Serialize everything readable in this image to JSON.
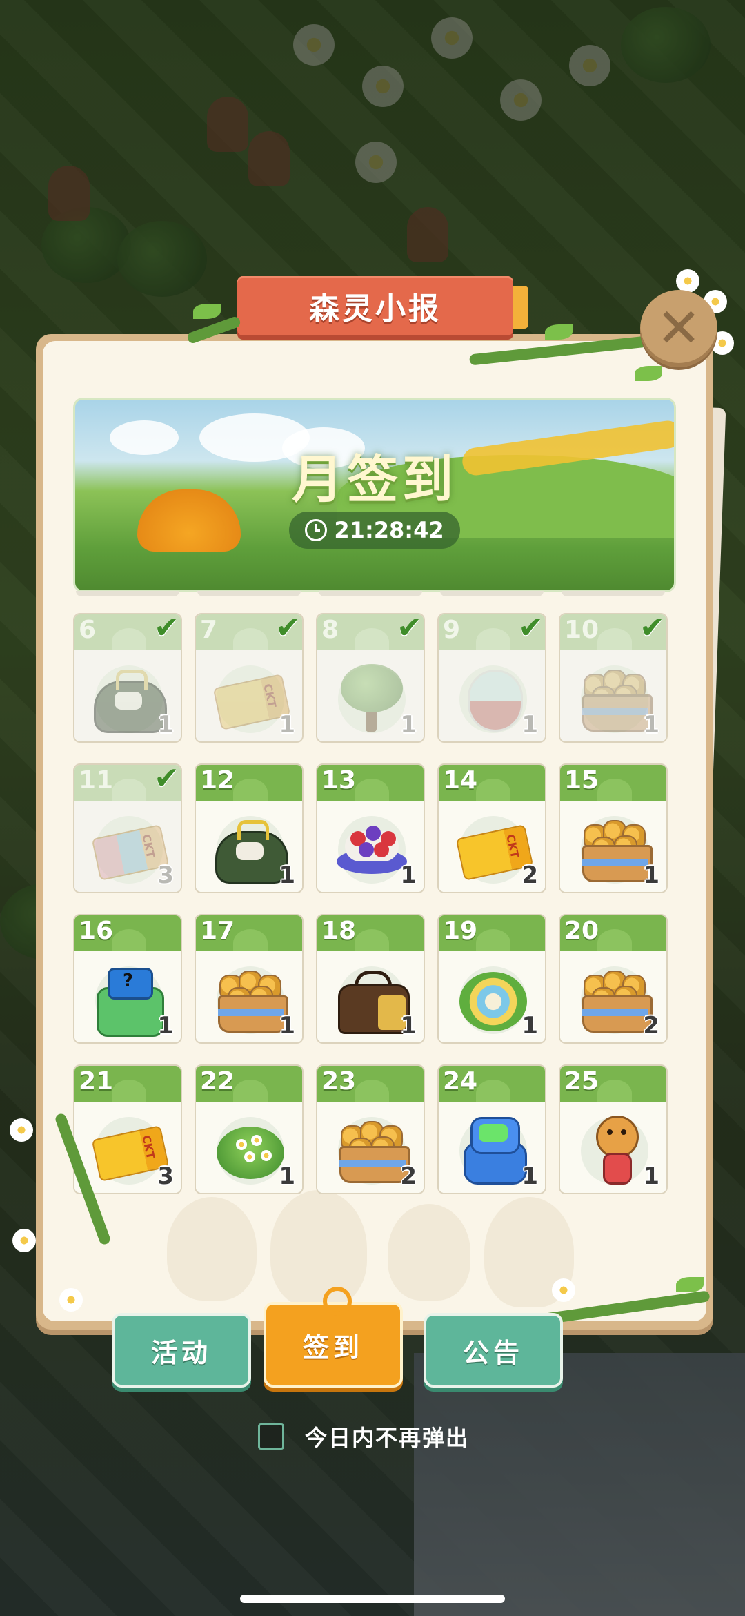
{
  "panel": {
    "title": "森灵小报",
    "close_icon": "close-x-icon"
  },
  "header": {
    "title": "月签到",
    "timer": "21:28:42",
    "timer_icon": "clock-icon"
  },
  "days": [
    {
      "day": "6",
      "qty": "1",
      "claimed": true,
      "item": "purse"
    },
    {
      "day": "7",
      "qty": "1",
      "claimed": true,
      "item": "ticket"
    },
    {
      "day": "8",
      "qty": "1",
      "claimed": true,
      "item": "tree"
    },
    {
      "day": "9",
      "qty": "1",
      "claimed": true,
      "item": "capsule"
    },
    {
      "day": "10",
      "qty": "1",
      "claimed": true,
      "item": "giraffe-basket"
    },
    {
      "day": "11",
      "qty": "3",
      "claimed": true,
      "item": "colorful-ticket"
    },
    {
      "day": "12",
      "qty": "1",
      "claimed": false,
      "item": "purse"
    },
    {
      "day": "13",
      "qty": "1",
      "claimed": false,
      "item": "berry-cake"
    },
    {
      "day": "14",
      "qty": "2",
      "claimed": false,
      "item": "ticket"
    },
    {
      "day": "15",
      "qty": "1",
      "claimed": false,
      "item": "giraffe-basket"
    },
    {
      "day": "16",
      "qty": "1",
      "claimed": false,
      "item": "mystery-bag"
    },
    {
      "day": "17",
      "qty": "1",
      "claimed": false,
      "item": "giraffe-basket"
    },
    {
      "day": "18",
      "qty": "1",
      "claimed": false,
      "item": "handbag"
    },
    {
      "day": "19",
      "qty": "1",
      "claimed": false,
      "item": "bouquet"
    },
    {
      "day": "20",
      "qty": "2",
      "claimed": false,
      "item": "giraffe-basket"
    },
    {
      "day": "21",
      "qty": "3",
      "claimed": false,
      "item": "ticket"
    },
    {
      "day": "22",
      "qty": "1",
      "claimed": false,
      "item": "flower-bush"
    },
    {
      "day": "23",
      "qty": "2",
      "claimed": false,
      "item": "giraffe-basket"
    },
    {
      "day": "24",
      "qty": "1",
      "claimed": false,
      "item": "robot-bag"
    },
    {
      "day": "25",
      "qty": "1",
      "claimed": false,
      "item": "giraffe-doll"
    }
  ],
  "tabs": {
    "activity": "活动",
    "checkin": "签到",
    "notice": "公告"
  },
  "dont_show": {
    "label": "今日内不再弹出",
    "checked": false
  },
  "colors": {
    "accent_green": "#7ab54e",
    "title_red": "#e4694b",
    "checkin_orange": "#f4a11f",
    "tab_teal": "#5eb69a"
  }
}
